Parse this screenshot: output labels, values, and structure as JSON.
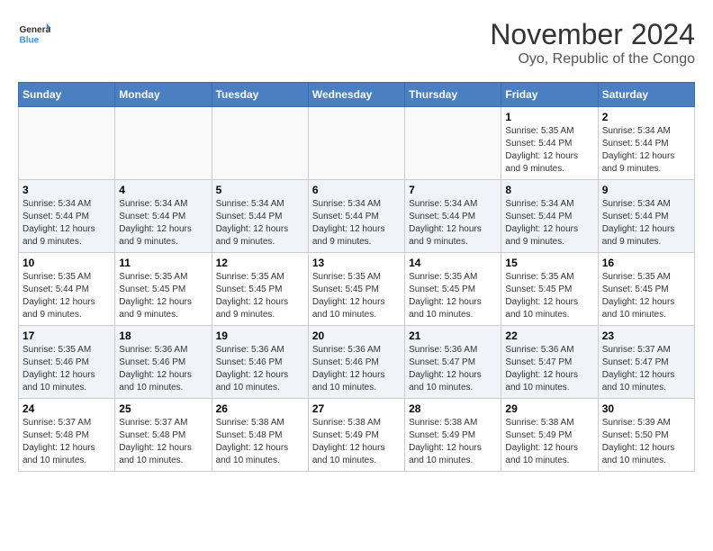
{
  "header": {
    "logo_line1": "General",
    "logo_line2": "Blue",
    "month_title": "November 2024",
    "location": "Oyo, Republic of the Congo"
  },
  "days_of_week": [
    "Sunday",
    "Monday",
    "Tuesday",
    "Wednesday",
    "Thursday",
    "Friday",
    "Saturday"
  ],
  "weeks": [
    [
      {
        "day": "",
        "info": ""
      },
      {
        "day": "",
        "info": ""
      },
      {
        "day": "",
        "info": ""
      },
      {
        "day": "",
        "info": ""
      },
      {
        "day": "",
        "info": ""
      },
      {
        "day": "1",
        "info": "Sunrise: 5:35 AM\nSunset: 5:44 PM\nDaylight: 12 hours and 9 minutes."
      },
      {
        "day": "2",
        "info": "Sunrise: 5:34 AM\nSunset: 5:44 PM\nDaylight: 12 hours and 9 minutes."
      }
    ],
    [
      {
        "day": "3",
        "info": "Sunrise: 5:34 AM\nSunset: 5:44 PM\nDaylight: 12 hours and 9 minutes."
      },
      {
        "day": "4",
        "info": "Sunrise: 5:34 AM\nSunset: 5:44 PM\nDaylight: 12 hours and 9 minutes."
      },
      {
        "day": "5",
        "info": "Sunrise: 5:34 AM\nSunset: 5:44 PM\nDaylight: 12 hours and 9 minutes."
      },
      {
        "day": "6",
        "info": "Sunrise: 5:34 AM\nSunset: 5:44 PM\nDaylight: 12 hours and 9 minutes."
      },
      {
        "day": "7",
        "info": "Sunrise: 5:34 AM\nSunset: 5:44 PM\nDaylight: 12 hours and 9 minutes."
      },
      {
        "day": "8",
        "info": "Sunrise: 5:34 AM\nSunset: 5:44 PM\nDaylight: 12 hours and 9 minutes."
      },
      {
        "day": "9",
        "info": "Sunrise: 5:34 AM\nSunset: 5:44 PM\nDaylight: 12 hours and 9 minutes."
      }
    ],
    [
      {
        "day": "10",
        "info": "Sunrise: 5:35 AM\nSunset: 5:44 PM\nDaylight: 12 hours and 9 minutes."
      },
      {
        "day": "11",
        "info": "Sunrise: 5:35 AM\nSunset: 5:45 PM\nDaylight: 12 hours and 9 minutes."
      },
      {
        "day": "12",
        "info": "Sunrise: 5:35 AM\nSunset: 5:45 PM\nDaylight: 12 hours and 9 minutes."
      },
      {
        "day": "13",
        "info": "Sunrise: 5:35 AM\nSunset: 5:45 PM\nDaylight: 12 hours and 10 minutes."
      },
      {
        "day": "14",
        "info": "Sunrise: 5:35 AM\nSunset: 5:45 PM\nDaylight: 12 hours and 10 minutes."
      },
      {
        "day": "15",
        "info": "Sunrise: 5:35 AM\nSunset: 5:45 PM\nDaylight: 12 hours and 10 minutes."
      },
      {
        "day": "16",
        "info": "Sunrise: 5:35 AM\nSunset: 5:45 PM\nDaylight: 12 hours and 10 minutes."
      }
    ],
    [
      {
        "day": "17",
        "info": "Sunrise: 5:35 AM\nSunset: 5:46 PM\nDaylight: 12 hours and 10 minutes."
      },
      {
        "day": "18",
        "info": "Sunrise: 5:36 AM\nSunset: 5:46 PM\nDaylight: 12 hours and 10 minutes."
      },
      {
        "day": "19",
        "info": "Sunrise: 5:36 AM\nSunset: 5:46 PM\nDaylight: 12 hours and 10 minutes."
      },
      {
        "day": "20",
        "info": "Sunrise: 5:36 AM\nSunset: 5:46 PM\nDaylight: 12 hours and 10 minutes."
      },
      {
        "day": "21",
        "info": "Sunrise: 5:36 AM\nSunset: 5:47 PM\nDaylight: 12 hours and 10 minutes."
      },
      {
        "day": "22",
        "info": "Sunrise: 5:36 AM\nSunset: 5:47 PM\nDaylight: 12 hours and 10 minutes."
      },
      {
        "day": "23",
        "info": "Sunrise: 5:37 AM\nSunset: 5:47 PM\nDaylight: 12 hours and 10 minutes."
      }
    ],
    [
      {
        "day": "24",
        "info": "Sunrise: 5:37 AM\nSunset: 5:48 PM\nDaylight: 12 hours and 10 minutes."
      },
      {
        "day": "25",
        "info": "Sunrise: 5:37 AM\nSunset: 5:48 PM\nDaylight: 12 hours and 10 minutes."
      },
      {
        "day": "26",
        "info": "Sunrise: 5:38 AM\nSunset: 5:48 PM\nDaylight: 12 hours and 10 minutes."
      },
      {
        "day": "27",
        "info": "Sunrise: 5:38 AM\nSunset: 5:49 PM\nDaylight: 12 hours and 10 minutes."
      },
      {
        "day": "28",
        "info": "Sunrise: 5:38 AM\nSunset: 5:49 PM\nDaylight: 12 hours and 10 minutes."
      },
      {
        "day": "29",
        "info": "Sunrise: 5:38 AM\nSunset: 5:49 PM\nDaylight: 12 hours and 10 minutes."
      },
      {
        "day": "30",
        "info": "Sunrise: 5:39 AM\nSunset: 5:50 PM\nDaylight: 12 hours and 10 minutes."
      }
    ]
  ]
}
